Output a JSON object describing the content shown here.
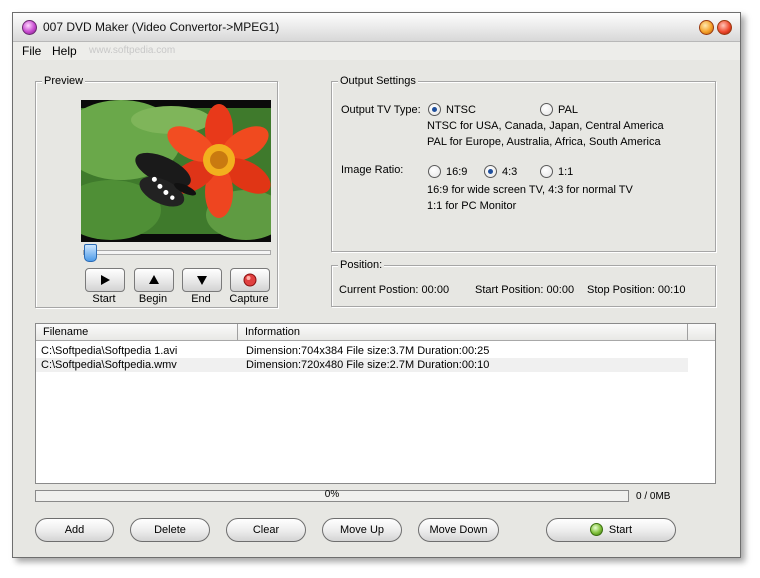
{
  "window": {
    "title": "007 DVD Maker (Video Convertor->MPEG1)"
  },
  "menu": {
    "file": "File",
    "help": "Help",
    "watermark": "www.softpedia.com"
  },
  "preview": {
    "title": "Preview",
    "playhead_fraction": 0.0,
    "buttons": [
      {
        "label": "Start",
        "icon": "play-icon"
      },
      {
        "label": "Begin",
        "icon": "triangle-up-icon"
      },
      {
        "label": "End",
        "icon": "triangle-down-icon"
      },
      {
        "label": "Capture",
        "icon": "record-icon"
      }
    ]
  },
  "output": {
    "title": "Output Settings",
    "tv_type_label": "Output TV Type:",
    "ntsc": "NTSC",
    "pal": "PAL",
    "tv_type_selected": "NTSC",
    "ntsc_note": "NTSC for USA, Canada, Japan, Central  America",
    "pal_note": "PAL for Europe, Australia, Africa, South America",
    "ratio_label": "Image Ratio:",
    "ratio_169": "16:9",
    "ratio_43": "4:3",
    "ratio_11": "1:1",
    "ratio_selected": "4:3",
    "ratio_note1": "16:9 for wide screen TV,  4:3 for normal TV",
    "ratio_note2": "1:1 for PC Monitor"
  },
  "position": {
    "title": "Position:",
    "current": "Current Postion: 00:00",
    "start": "Start Position: 00:00",
    "stop": "Stop Position: 00:10"
  },
  "files": {
    "columns": [
      "Filename",
      "Information"
    ],
    "rows": [
      {
        "filename": "C:\\Softpedia\\Softpedia 1.avi",
        "info": "Dimension:704x384 File size:3.7M Duration:00:25"
      },
      {
        "filename": "C:\\Softpedia\\Softpedia.wmv",
        "info": "Dimension:720x480 File size:2.7M Duration:00:10"
      }
    ]
  },
  "progress": {
    "percent": 0,
    "text": "0%",
    "size": "0 / 0MB"
  },
  "buttons": {
    "add": "Add",
    "delete": "Delete",
    "clear": "Clear",
    "move_up": "Move Up",
    "move_down": "Move Down",
    "start": "Start"
  },
  "colors": {
    "window_bg": "#e7e7e3",
    "progress_fill": "#6e9fd6",
    "radio_dot": "#1f4f9c"
  }
}
